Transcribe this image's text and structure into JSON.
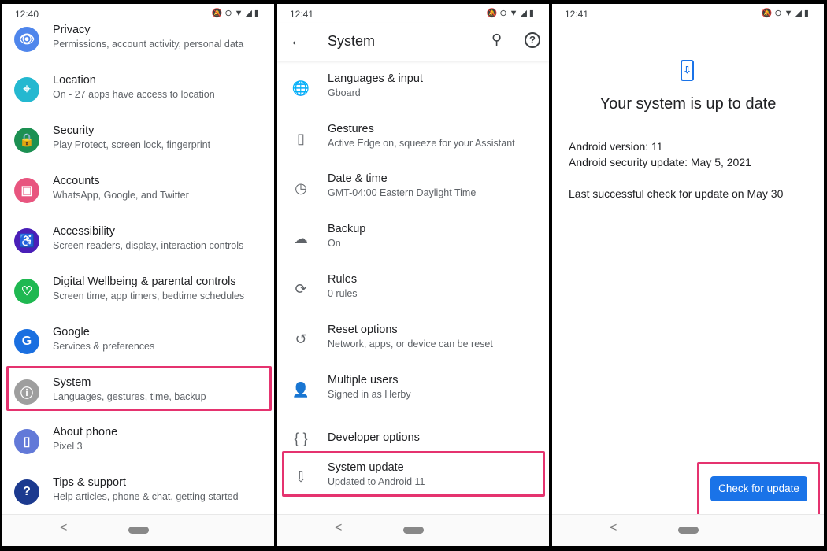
{
  "panel1": {
    "time": "12:40",
    "status_icons": "🔕⊖▼◢▮",
    "items": [
      {
        "title": "Privacy",
        "subtitle": "Permissions, account activity, personal data",
        "icon": "privacy-eye-icon",
        "color": "#4f86ec",
        "glyph": "👁"
      },
      {
        "title": "Location",
        "subtitle": "On - 27 apps have access to location",
        "icon": "location-pin-icon",
        "color": "#24b8d0",
        "glyph": "⌖"
      },
      {
        "title": "Security",
        "subtitle": "Play Protect, screen lock, fingerprint",
        "icon": "lock-icon",
        "color": "#1c9052",
        "glyph": "🔒"
      },
      {
        "title": "Accounts",
        "subtitle": "WhatsApp, Google, and Twitter",
        "icon": "account-icon",
        "color": "#e8557f",
        "glyph": "▣"
      },
      {
        "title": "Accessibility",
        "subtitle": "Screen readers, display, interaction controls",
        "icon": "accessibility-icon",
        "color": "#4a1fb8",
        "glyph": "♿"
      },
      {
        "title": "Digital Wellbeing & parental controls",
        "subtitle": "Screen time, app timers, bedtime schedules",
        "icon": "wellbeing-heart-icon",
        "color": "#1fb851",
        "glyph": "♡"
      },
      {
        "title": "Google",
        "subtitle": "Services & preferences",
        "icon": "google-g-icon",
        "color": "#1a6fe0",
        "glyph": "G"
      },
      {
        "title": "System",
        "subtitle": "Languages, gestures, time, backup",
        "icon": "info-icon",
        "color": "#9e9e9e",
        "glyph": "ⓘ"
      },
      {
        "title": "About phone",
        "subtitle": "Pixel 3",
        "icon": "phone-info-icon",
        "color": "#6279d8",
        "glyph": "▯"
      },
      {
        "title": "Tips & support",
        "subtitle": "Help articles, phone & chat, getting started",
        "icon": "help-icon",
        "color": "#1c3a8f",
        "glyph": "?"
      }
    ]
  },
  "panel2": {
    "time": "12:41",
    "status_icons": "🔕⊖▼◢▮",
    "title": "System",
    "items": [
      {
        "title": "Languages & input",
        "subtitle": "Gboard",
        "icon": "globe-icon",
        "glyph": "🌐"
      },
      {
        "title": "Gestures",
        "subtitle": "Active Edge on, squeeze for your Assistant",
        "icon": "gestures-phone-icon",
        "glyph": "▯"
      },
      {
        "title": "Date & time",
        "subtitle": "GMT-04:00 Eastern Daylight Time",
        "icon": "clock-icon",
        "glyph": "◷"
      },
      {
        "title": "Backup",
        "subtitle": "On",
        "icon": "cloud-upload-icon",
        "glyph": "☁"
      },
      {
        "title": "Rules",
        "subtitle": "0 rules",
        "icon": "rules-icon",
        "glyph": "⟳"
      },
      {
        "title": "Reset options",
        "subtitle": "Network, apps, or device can be reset",
        "icon": "history-icon",
        "glyph": "↺"
      },
      {
        "title": "Multiple users",
        "subtitle": "Signed in as Herby",
        "icon": "person-icon",
        "glyph": "👤"
      },
      {
        "title": "Developer options",
        "subtitle": "",
        "icon": "braces-icon",
        "glyph": "{ }"
      },
      {
        "title": "System update",
        "subtitle": "Updated to Android 11",
        "icon": "system-update-icon",
        "glyph": "⇩"
      }
    ]
  },
  "panel3": {
    "time": "12:41",
    "status_icons": "🔕⊖▼◢▮",
    "title": "Your system is up to date",
    "android_version": "Android version: 11",
    "security_update": "Android security update: May 5, 2021",
    "last_check": "Last successful check for update on May 30",
    "button": "Check for update"
  },
  "colors": {
    "accent": "#1a73e8",
    "highlight": "#e5336f"
  }
}
